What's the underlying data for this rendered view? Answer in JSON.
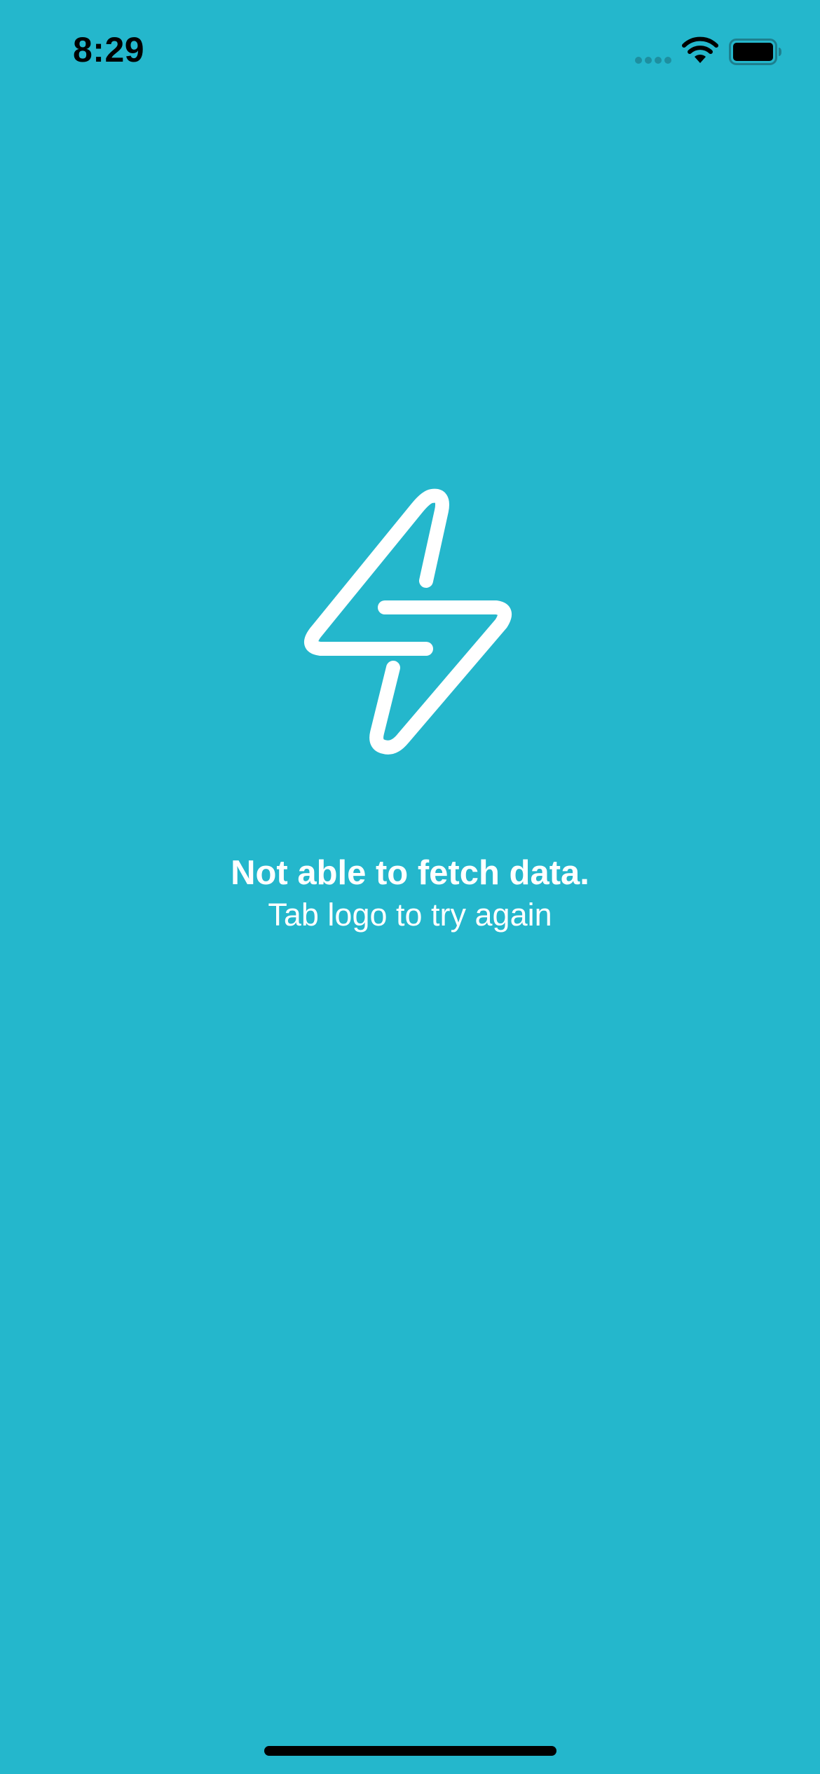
{
  "status_bar": {
    "time": "8:29",
    "signal_icon": "cellular-signal-dots-icon",
    "wifi_icon": "wifi-icon",
    "battery_icon": "battery-full-icon"
  },
  "logo": {
    "icon": "lightning-bolt-icon",
    "color": "#ffffff"
  },
  "message": {
    "title": "Not able to fetch data.",
    "subtitle": "Tab logo to try again"
  },
  "colors": {
    "background": "#24b7cc",
    "text": "#ffffff",
    "status_text": "#000000"
  }
}
